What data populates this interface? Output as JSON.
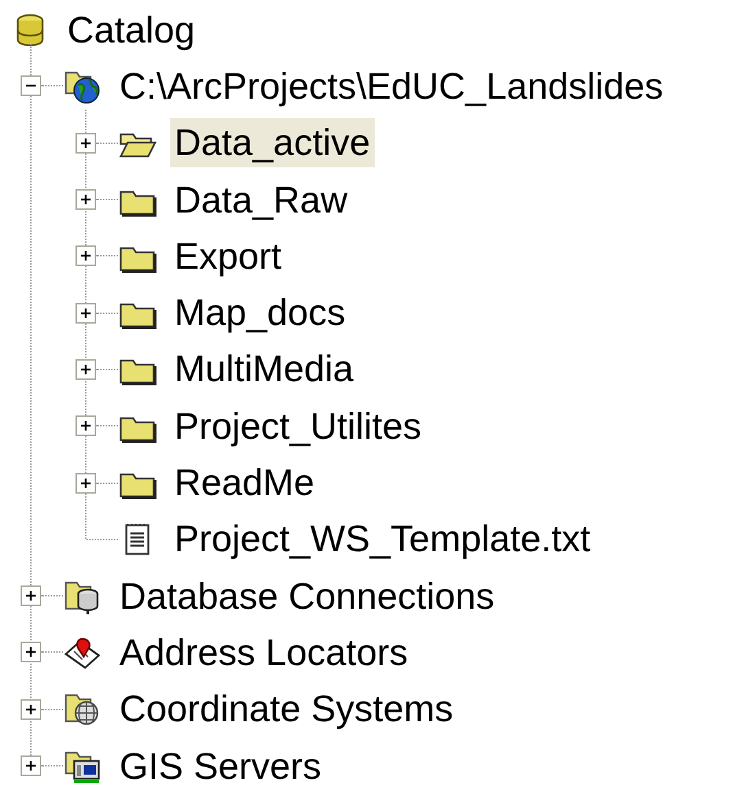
{
  "tree": {
    "label": "Catalog",
    "kind": "catalog",
    "selected": false,
    "children": [
      {
        "label": "C:\\ArcProjects\\EdUC_Landslides",
        "kind": "folder_connection",
        "expanded": true,
        "selected": false,
        "children": [
          {
            "label": "Data_active",
            "kind": "folder",
            "expanded": false,
            "selected": true
          },
          {
            "label": "Data_Raw",
            "kind": "folder",
            "expanded": false,
            "selected": false
          },
          {
            "label": "Export",
            "kind": "folder",
            "expanded": false,
            "selected": false
          },
          {
            "label": "Map_docs",
            "kind": "folder",
            "expanded": false,
            "selected": false
          },
          {
            "label": "MultiMedia",
            "kind": "folder",
            "expanded": false,
            "selected": false
          },
          {
            "label": "Project_Utilites",
            "kind": "folder",
            "expanded": false,
            "selected": false
          },
          {
            "label": "ReadMe",
            "kind": "folder",
            "expanded": false,
            "selected": false
          },
          {
            "label": "Project_WS_Template.txt",
            "kind": "file",
            "selected": false
          }
        ]
      },
      {
        "label": "Database Connections",
        "kind": "database_connections",
        "expanded": false,
        "selected": false
      },
      {
        "label": "Address Locators",
        "kind": "address_locators",
        "expanded": false,
        "selected": false
      },
      {
        "label": "Coordinate Systems",
        "kind": "coordinate_systems",
        "expanded": false,
        "selected": false
      },
      {
        "label": "GIS Servers",
        "kind": "gis_servers",
        "expanded": false,
        "selected": false
      }
    ]
  }
}
